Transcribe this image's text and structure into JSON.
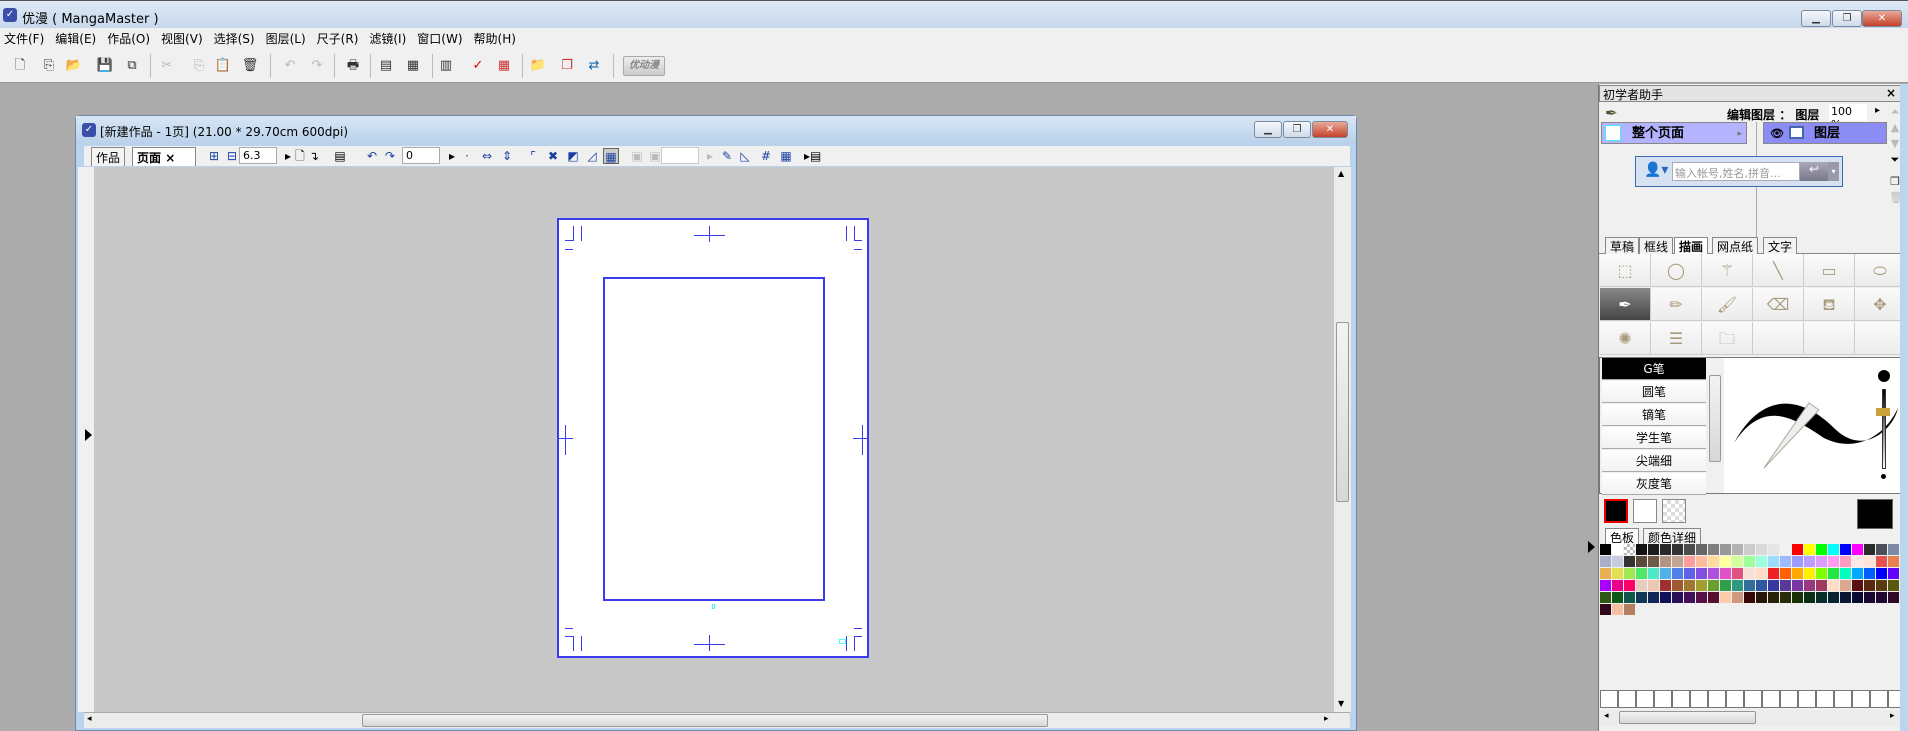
{
  "app": {
    "title": "优漫 ( MangaMaster )",
    "window_controls": [
      "minimize",
      "maximize",
      "close"
    ]
  },
  "menu": [
    "文件(F)",
    "编辑(E)",
    "作品(O)",
    "视图(V)",
    "选择(S)",
    "图层(L)",
    "尺子(R)",
    "滤镜(I)",
    "窗口(W)",
    "帮助(H)"
  ],
  "toolbar": {
    "brand_button": "优动漫",
    "icons": [
      "new-page-icon",
      "new-work-icon",
      "open-folder-icon",
      "save-icon",
      "save-all-icon",
      "cut-icon",
      "copy-icon",
      "paste-icon",
      "delete-icon",
      "undo-icon",
      "redo-icon",
      "print-icon",
      "page-settings-icon",
      "work-settings-icon",
      "layer-panel-icon",
      "check-icon",
      "color-grid-icon",
      "material-icon",
      "window-icon",
      "swap-window-icon"
    ]
  },
  "document": {
    "title": "[新建作品 - 1页] (21.00 * 29.70cm 600dpi)",
    "tabs": [
      {
        "label": "作品",
        "active": false
      },
      {
        "label": "页面",
        "active": true,
        "close": "×"
      }
    ],
    "zoom_value": "6.3",
    "rotation_value": "0",
    "blank_value": ""
  },
  "panel": {
    "title": "初学者助手",
    "close": "×",
    "edit_layer_label": "编辑图层",
    "colon": "：",
    "layer_label": "图层",
    "opacity": "100 %",
    "page_item": "整个页面",
    "layer_item": "图层",
    "login_placeholder": "输入帐号,姓名,拼音...",
    "tool_tabs": [
      {
        "label": "草稿"
      },
      {
        "label": "框线"
      },
      {
        "label": "描画",
        "active": true
      },
      {
        "label": "网点纸"
      },
      {
        "label": "文字"
      }
    ],
    "pens": [
      {
        "label": "G笔",
        "selected": true
      },
      {
        "label": "圆笔"
      },
      {
        "label": "镝笔"
      },
      {
        "label": "学生笔"
      },
      {
        "label": "尖端细"
      },
      {
        "label": "灰度笔"
      }
    ],
    "brush_size_fraction": 0.2,
    "color_tabs": [
      {
        "label": "色板",
        "active": true
      },
      {
        "label": "颜色详细"
      }
    ],
    "colors": {
      "main": "#000000",
      "sub": "#ffffff",
      "accent_line": "#3b3bf0"
    },
    "palette": [
      "#000000",
      "#ffffff",
      "transparent",
      "#111111",
      "#1c1c1c",
      "#292929",
      "#333333",
      "#4c4c4c",
      "#666666",
      "#808080",
      "#999999",
      "#b2b2b2",
      "#cccccc",
      "#d9d9d9",
      "#e6e6e6",
      "#f2f2f2",
      "#ff0000",
      "#ffff00",
      "#00ff00",
      "#00ffff",
      "#0000ff",
      "#ff00ff",
      "#2b2b2b",
      "#4a4f5a",
      "#7b8ba8",
      "#a8b0c8",
      "#c8cce0",
      "#333330",
      "#5a4a3c",
      "#6e5a48",
      "#b49480",
      "#c4a494",
      "#ff9c9c",
      "#ffbc9c",
      "#ffdc9c",
      "#ffff9c",
      "#d0ff9c",
      "#9cff9c",
      "#9cffe0",
      "#9cdcff",
      "#9cbcff",
      "#9c9cff",
      "#bc9cff",
      "#dc9cff",
      "#ff9cf0",
      "#ff9cc0",
      "#fbe8e4",
      "#ffe4d8",
      "#e85050",
      "#e88050",
      "#e8b050",
      "#e0e050",
      "#a0e850",
      "#50e868",
      "#50e8c8",
      "#50b0e8",
      "#5080e8",
      "#6060e8",
      "#8050e0",
      "#b050e0",
      "#e050c8",
      "#e05080",
      "#f8e0d8",
      "#ffdcc8",
      "#f02020",
      "#ff6000",
      "#ffa800",
      "#fff000",
      "#80ff00",
      "#20e840",
      "#00ffc0",
      "#00a8ff",
      "#0060ff",
      "#0000ff",
      "#6000ff",
      "#a800ff",
      "#e8008c",
      "#ff0068",
      "#e8ccc0",
      "#ecc8b4",
      "#a03030",
      "#a05830",
      "#a07830",
      "#a0a030",
      "#68a030",
      "#30a048",
      "#309880",
      "#307098",
      "#3058a0",
      "#3838a0",
      "#583898",
      "#7838a0",
      "#983880",
      "#a03860",
      "#ffdcc8",
      "#dca890",
      "#581010",
      "#582810",
      "#583c10",
      "#585810",
      "#305810",
      "#105818",
      "#105848",
      "#103858",
      "#102858",
      "#101058",
      "#281058",
      "#401058",
      "#581048",
      "#581030",
      "#ffccaa",
      "#d09880",
      "#380808",
      "#281808",
      "#282008",
      "#282c08",
      "#1c3008",
      "#083010",
      "#083028",
      "#082430",
      "#081830",
      "#080830",
      "#180830",
      "#200830",
      "#300828",
      "#300818",
      "#f4c0a0",
      "#b48060"
    ]
  }
}
